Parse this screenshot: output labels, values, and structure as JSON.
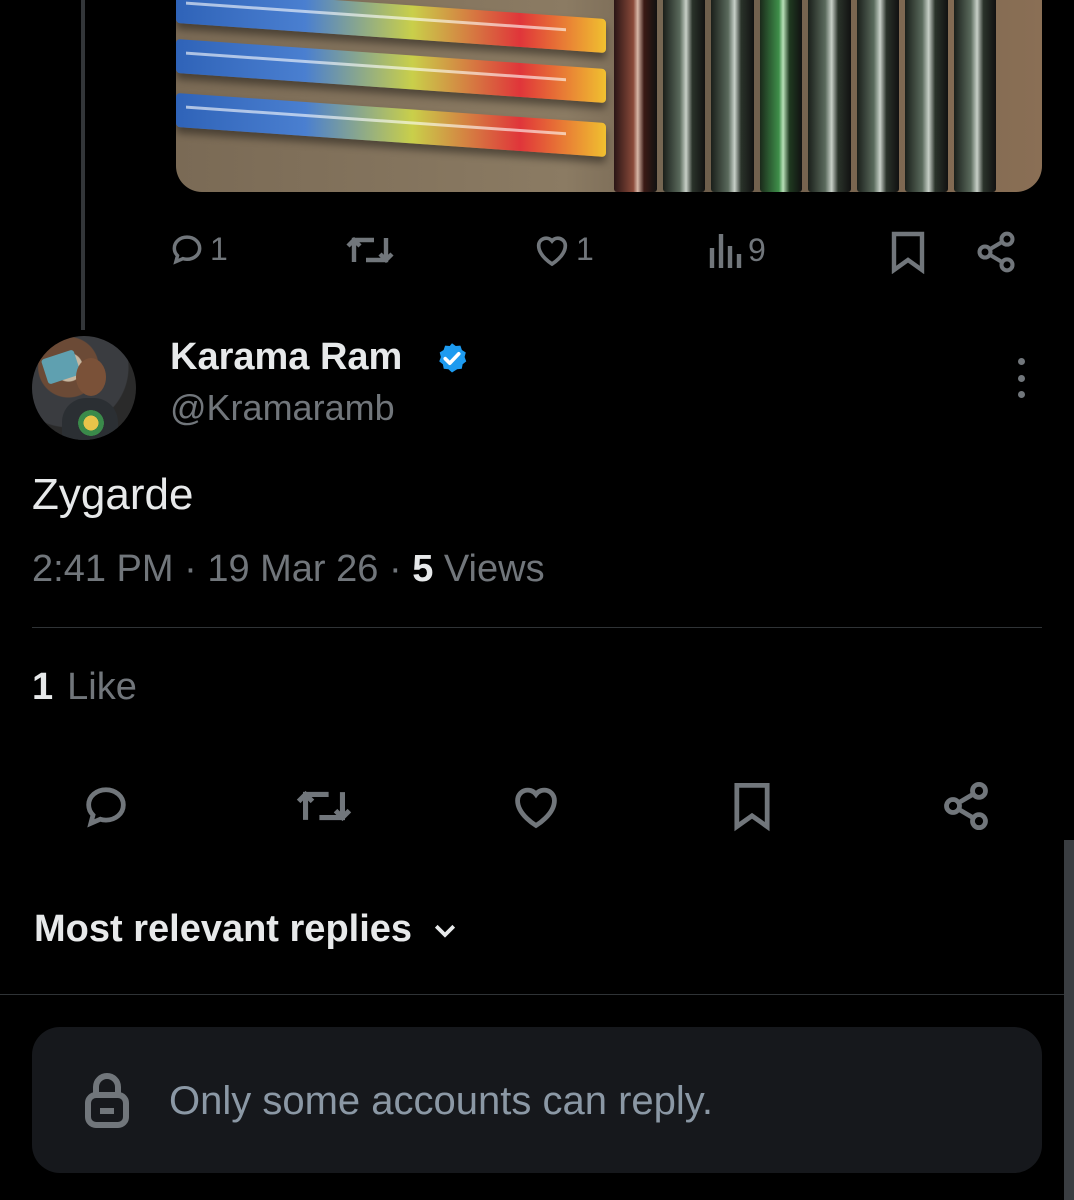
{
  "parent_tweet": {
    "actions": {
      "reply_count": "1",
      "like_count": "1",
      "view_count": "9"
    }
  },
  "tweet": {
    "author_name": "Karama Ram",
    "author_handle": "@Kramaramb",
    "verified": true,
    "text": "Zygarde",
    "time": "2:41 PM",
    "date": "19 Mar 26",
    "views_count": "5",
    "views_label": "Views",
    "likes_count": "1",
    "likes_label": "Like"
  },
  "replies": {
    "sort_label": "Most relevant replies",
    "restriction_text": "Only some accounts can reply."
  },
  "icons": {
    "reply": "comment-icon",
    "retweet": "retweet-icon",
    "like": "heart-icon",
    "views": "analytics-icon",
    "bookmark": "bookmark-icon",
    "share": "share-icon",
    "verified": "verified-badge-icon",
    "more": "more-vertical-icon",
    "lock": "lock-icon",
    "chevron": "chevron-down-icon"
  },
  "colors": {
    "background": "#000000",
    "text_primary": "#e7e9ea",
    "text_secondary": "#71767b",
    "verified": "#1d9bf0",
    "divider": "#2f3336",
    "reply_box": "#16181c"
  }
}
